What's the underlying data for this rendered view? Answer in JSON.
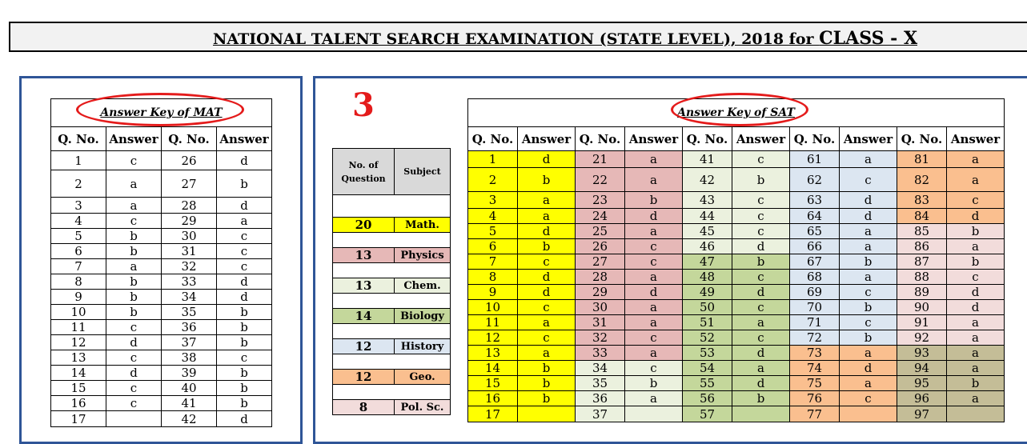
{
  "header": {
    "title_main": "NATIONAL TALENT SEARCH EXAMINATION (STATE LEVEL), 2018 for ",
    "title_class": "CLASS - X"
  },
  "section_number": "3",
  "mat": {
    "caption": "Answer Key of MAT",
    "headers": [
      "Q. No.",
      "Answer",
      "Q. No.",
      "Answer"
    ],
    "rows": [
      [
        "1",
        "c",
        "26",
        "d"
      ],
      [
        "2",
        "a",
        "27",
        "b"
      ],
      [
        "3",
        "a",
        "28",
        "d"
      ],
      [
        "4",
        "c",
        "29",
        "a"
      ],
      [
        "5",
        "b",
        "30",
        "c"
      ],
      [
        "6",
        "b",
        "31",
        "c"
      ],
      [
        "7",
        "a",
        "32",
        "c"
      ],
      [
        "8",
        "b",
        "33",
        "d"
      ],
      [
        "9",
        "b",
        "34",
        "d"
      ],
      [
        "10",
        "b",
        "35",
        "b"
      ],
      [
        "11",
        "c",
        "36",
        "b"
      ],
      [
        "12",
        "d",
        "37",
        "b"
      ],
      [
        "13",
        "c",
        "38",
        "c"
      ],
      [
        "14",
        "d",
        "39",
        "b"
      ],
      [
        "15",
        "c",
        "40",
        "b"
      ],
      [
        "16",
        "c",
        "41",
        "b"
      ],
      [
        "17",
        "",
        "42",
        "d"
      ]
    ]
  },
  "subjects": {
    "headers": [
      "No. of Question",
      "Subject"
    ],
    "rows": [
      {
        "count": "20",
        "name": "Math.",
        "color": "#ffff00"
      },
      {
        "count": "13",
        "name": "Physics",
        "color": "#e6b8b7"
      },
      {
        "count": "13",
        "name": "Chem.",
        "color": "#ebf1de"
      },
      {
        "count": "14",
        "name": "Biology",
        "color": "#c4d79b"
      },
      {
        "count": "12",
        "name": "History",
        "color": "#dce6f1"
      },
      {
        "count": "12",
        "name": "Geo.",
        "color": "#fabf8f"
      },
      {
        "count": "8",
        "name": "Pol. Sc.",
        "color": "#f2dcdb"
      }
    ]
  },
  "sat": {
    "caption": "Answer Key of SAT",
    "headers": [
      "Q. No.",
      "Answer",
      "Q. No.",
      "Answer",
      "Q. No.",
      "Answer",
      "Q. No.",
      "Answer",
      "Q. No.",
      "Answer"
    ],
    "rows": [
      [
        [
          "1",
          "d",
          "yel"
        ],
        [
          "21",
          "a",
          "pink"
        ],
        [
          "41",
          "c",
          "lgreen"
        ],
        [
          "61",
          "a",
          "lblue"
        ],
        [
          "81",
          "a",
          "orange"
        ]
      ],
      [
        [
          "2",
          "b",
          "yel"
        ],
        [
          "22",
          "a",
          "pink"
        ],
        [
          "42",
          "b",
          "lgreen"
        ],
        [
          "62",
          "c",
          "lblue"
        ],
        [
          "82",
          "a",
          "orange"
        ]
      ],
      [
        [
          "3",
          "a",
          "yel"
        ],
        [
          "23",
          "b",
          "pink"
        ],
        [
          "43",
          "c",
          "lgreen"
        ],
        [
          "63",
          "d",
          "lblue"
        ],
        [
          "83",
          "c",
          "orange"
        ]
      ],
      [
        [
          "4",
          "a",
          "yel"
        ],
        [
          "24",
          "d",
          "pink"
        ],
        [
          "44",
          "c",
          "lgreen"
        ],
        [
          "64",
          "d",
          "lblue"
        ],
        [
          "84",
          "d",
          "orange"
        ]
      ],
      [
        [
          "5",
          "d",
          "yel"
        ],
        [
          "25",
          "a",
          "pink"
        ],
        [
          "45",
          "c",
          "lgreen"
        ],
        [
          "65",
          "a",
          "lblue"
        ],
        [
          "85",
          "b",
          "lpink"
        ]
      ],
      [
        [
          "6",
          "b",
          "yel"
        ],
        [
          "26",
          "c",
          "pink"
        ],
        [
          "46",
          "d",
          "lgreen"
        ],
        [
          "66",
          "a",
          "lblue"
        ],
        [
          "86",
          "a",
          "lpink"
        ]
      ],
      [
        [
          "7",
          "c",
          "yel"
        ],
        [
          "27",
          "c",
          "pink"
        ],
        [
          "47",
          "b",
          "green"
        ],
        [
          "67",
          "b",
          "lblue"
        ],
        [
          "87",
          "b",
          "lpink"
        ]
      ],
      [
        [
          "8",
          "d",
          "yel"
        ],
        [
          "28",
          "a",
          "pink"
        ],
        [
          "48",
          "c",
          "green"
        ],
        [
          "68",
          "a",
          "lblue"
        ],
        [
          "88",
          "c",
          "lpink"
        ]
      ],
      [
        [
          "9",
          "d",
          "yel"
        ],
        [
          "29",
          "d",
          "pink"
        ],
        [
          "49",
          "d",
          "green"
        ],
        [
          "69",
          "c",
          "lblue"
        ],
        [
          "89",
          "d",
          "lpink"
        ]
      ],
      [
        [
          "10",
          "c",
          "yel"
        ],
        [
          "30",
          "a",
          "pink"
        ],
        [
          "50",
          "c",
          "green"
        ],
        [
          "70",
          "b",
          "lblue"
        ],
        [
          "90",
          "d",
          "lpink"
        ]
      ],
      [
        [
          "11",
          "a",
          "yel"
        ],
        [
          "31",
          "a",
          "pink"
        ],
        [
          "51",
          "a",
          "green"
        ],
        [
          "71",
          "c",
          "lblue"
        ],
        [
          "91",
          "a",
          "lpink"
        ]
      ],
      [
        [
          "12",
          "c",
          "yel"
        ],
        [
          "32",
          "c",
          "pink"
        ],
        [
          "52",
          "c",
          "green"
        ],
        [
          "72",
          "b",
          "lblue"
        ],
        [
          "92",
          "a",
          "lpink"
        ]
      ],
      [
        [
          "13",
          "a",
          "yel"
        ],
        [
          "33",
          "a",
          "pink"
        ],
        [
          "53",
          "d",
          "green"
        ],
        [
          "73",
          "a",
          "orange"
        ],
        [
          "93",
          "a",
          "khaki"
        ]
      ],
      [
        [
          "14",
          "b",
          "yel"
        ],
        [
          "34",
          "c",
          "lgreen"
        ],
        [
          "54",
          "a",
          "green"
        ],
        [
          "74",
          "d",
          "orange"
        ],
        [
          "94",
          "a",
          "khaki"
        ]
      ],
      [
        [
          "15",
          "b",
          "yel"
        ],
        [
          "35",
          "b",
          "lgreen"
        ],
        [
          "55",
          "d",
          "green"
        ],
        [
          "75",
          "a",
          "orange"
        ],
        [
          "95",
          "b",
          "khaki"
        ]
      ],
      [
        [
          "16",
          "b",
          "yel"
        ],
        [
          "36",
          "a",
          "lgreen"
        ],
        [
          "56",
          "b",
          "green"
        ],
        [
          "76",
          "c",
          "orange"
        ],
        [
          "96",
          "a",
          "khaki"
        ]
      ],
      [
        [
          "17",
          "",
          "yel"
        ],
        [
          "37",
          "",
          "lgreen"
        ],
        [
          "57",
          "",
          "green"
        ],
        [
          "77",
          "",
          "orange"
        ],
        [
          "97",
          "",
          "khaki"
        ]
      ]
    ]
  }
}
